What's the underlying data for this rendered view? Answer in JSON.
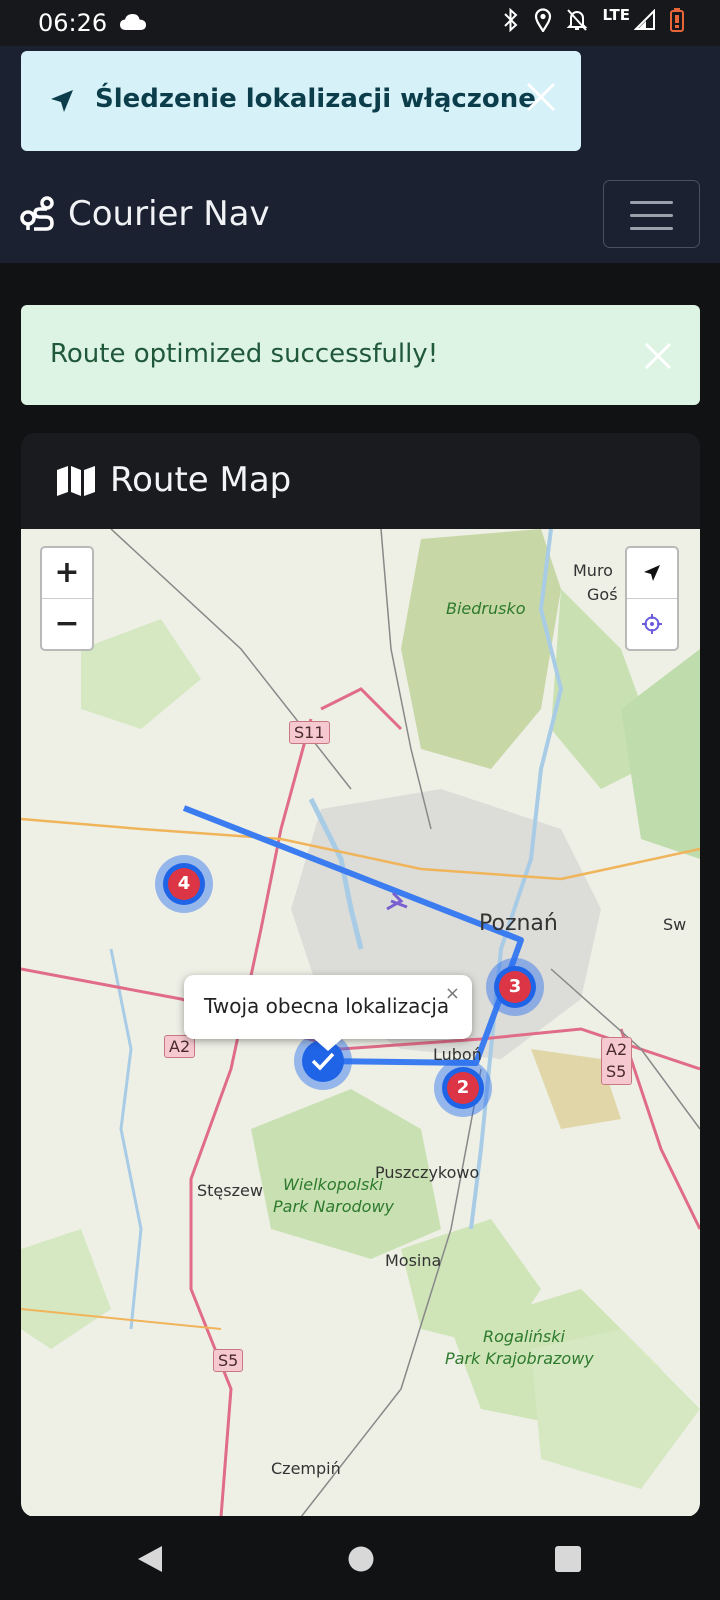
{
  "status_bar": {
    "time": "06:26",
    "network": "LTE"
  },
  "toast": {
    "text": "Śledzenie lokalizacji włączone",
    "icon": "location-arrow-icon"
  },
  "navbar": {
    "brand": "Courier Nav",
    "brand_icon": "route-icon",
    "menu_icon": "hamburger-icon"
  },
  "alert": {
    "text": "Route optimized successfully!"
  },
  "card": {
    "title": "Route Map",
    "title_icon": "map-icon"
  },
  "map": {
    "zoom_in": "+",
    "zoom_out": "−",
    "labels": {
      "biedrusko": "Biedrusko",
      "poznan": "Poznań",
      "murowana": "Muro",
      "goslin": "Goś",
      "sw": "Sw",
      "lubon": "Luboń",
      "puszczykowo": "Puszczykowo",
      "steszew": "Stęszew",
      "wielkopolski1": "Wielkopolski",
      "wielkopolski2": "Park Narodowy",
      "mosina": "Mosina",
      "rogalinski1": "Rogaliński",
      "rogalinski2": "Park Krajobrazowy",
      "czempin": "Czempiń"
    },
    "road_signs": {
      "s11": "S11",
      "a2_left": "A2",
      "a2_right": "A2",
      "s5_right": "S5",
      "s5_bottom": "S5"
    },
    "markers": [
      {
        "label": "4"
      },
      {
        "label": "3"
      },
      {
        "label": "2"
      }
    ],
    "popup": {
      "text": "Twoja obecna lokalizacja",
      "close": "×"
    },
    "colors": {
      "route": "#3b7cf0",
      "marker": "#1f63e6",
      "badge": "#dc3545"
    }
  }
}
